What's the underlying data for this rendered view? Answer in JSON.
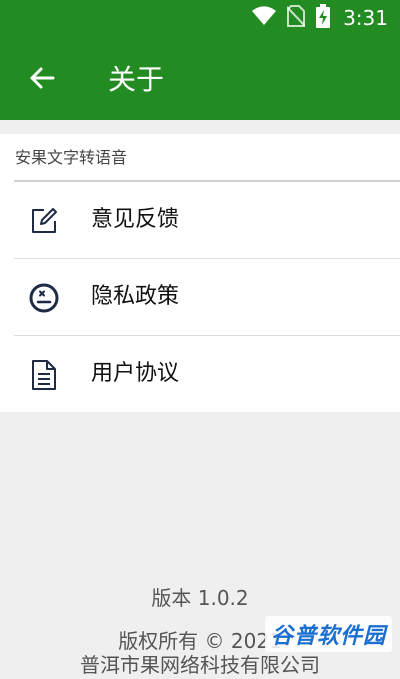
{
  "status_bar": {
    "time": "3:31",
    "icons": [
      "wifi-icon",
      "no-sim-icon",
      "battery-charging-icon"
    ]
  },
  "app_bar": {
    "back_icon": "arrow-left-icon",
    "title": "关于"
  },
  "settings": {
    "section_header": "安果文字转语音",
    "items": [
      {
        "icon": "edit-icon",
        "label": "意见反馈"
      },
      {
        "icon": "privacy-icon",
        "label": "隐私政策"
      },
      {
        "icon": "document-icon",
        "label": "用户协议"
      }
    ]
  },
  "footer": {
    "version": "版本 1.0.2",
    "copyright": "版权所有 © 2021",
    "company": "普洱市果网络科技有限公司"
  },
  "watermark": {
    "text": "谷普软件园"
  },
  "colors": {
    "primary": "#228b22",
    "background": "#efefef",
    "surface": "#ffffff",
    "icon": "#1f2a44"
  }
}
